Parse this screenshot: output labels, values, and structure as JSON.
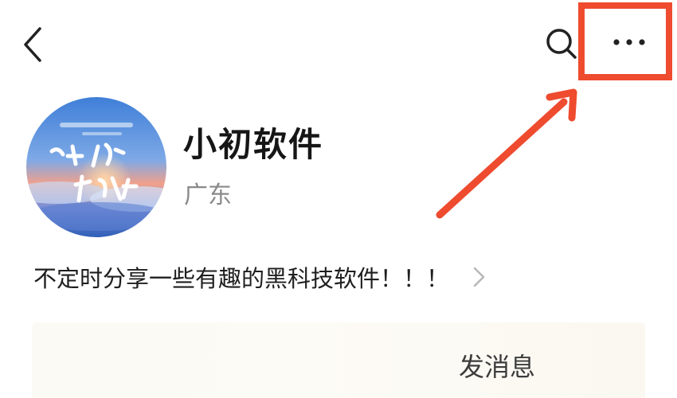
{
  "nav": {
    "back_icon": "chevron-left-icon",
    "search_icon": "search-icon",
    "more_icon": "more-horizontal-icon"
  },
  "profile": {
    "name": "小初软件",
    "region": "广东",
    "bio": "不定时分享一些有趣的黑科技软件！！！"
  },
  "actions": {
    "send_message_label": "发消息"
  },
  "annotation": {
    "color": "#ee4b2f"
  }
}
